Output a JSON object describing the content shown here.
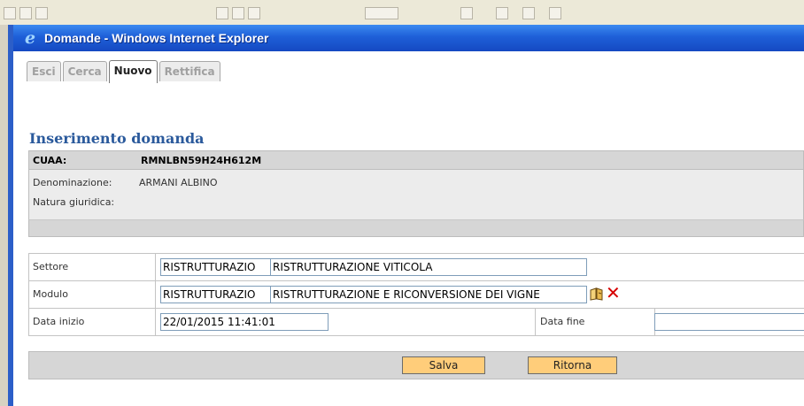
{
  "window": {
    "title": "Domande - Windows Internet Explorer"
  },
  "tabs": [
    {
      "label": "Esci",
      "active": false
    },
    {
      "label": "Cerca",
      "active": false
    },
    {
      "label": "Nuovo",
      "active": true
    },
    {
      "label": "Rettifica",
      "active": false
    }
  ],
  "section": {
    "title": "Inserimento domanda"
  },
  "info": {
    "cuaa_label": "CUAA:",
    "cuaa_value": "RMNLBN59H24H612M",
    "denominazione_label": "Denominazione:",
    "denominazione_value": "ARMANI ALBINO",
    "natura_label": "Natura giuridica:",
    "natura_value": ""
  },
  "form": {
    "settore": {
      "label": "Settore",
      "code": "RISTRUTTURAZIO",
      "description": "RISTRUTTURAZIONE VITICOLA"
    },
    "modulo": {
      "label": "Modulo",
      "code": "RISTRUTTURAZIO",
      "description": "RISTRUTTURAZIONE E RICONVERSIONE DEI VIGNE"
    },
    "data_inizio": {
      "label": "Data inizio",
      "value": "22/01/2015 11:41:01"
    },
    "data_fine": {
      "label": "Data fine",
      "value": ""
    }
  },
  "buttons": {
    "salva": "Salva",
    "ritorna": "Ritorna"
  },
  "icons": {
    "lookup": "book-lookup-icon",
    "clear": "delete-x-icon",
    "browser": "ie-logo-icon"
  },
  "colors": {
    "title_bar": "#1e5fd8",
    "section_title": "#2b5a9c",
    "button_bg": "#ffcd7a",
    "delete_icon": "#d60000"
  }
}
